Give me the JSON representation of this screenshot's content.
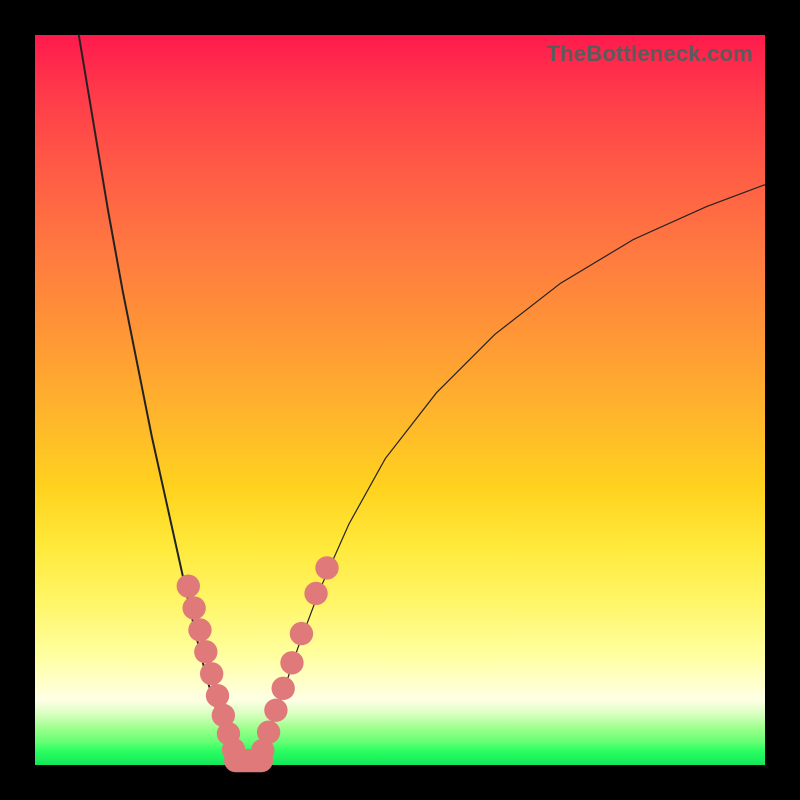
{
  "watermark": "TheBottleneck.com",
  "colors": {
    "frame": "#000000",
    "gradient_top": "#ff1a4d",
    "gradient_mid": "#ffd21e",
    "gradient_bottom": "#12e858",
    "curve": "#222222",
    "bead": "#e07a7a"
  },
  "chart_data": {
    "type": "line",
    "title": "",
    "xlabel": "",
    "ylabel": "",
    "xlim": [
      0,
      100
    ],
    "ylim": [
      0,
      100
    ],
    "series": [
      {
        "name": "left-curve",
        "x": [
          6,
          8,
          10,
          12,
          14,
          16,
          18,
          20,
          22,
          23.5,
          25,
          26,
          27,
          27.8
        ],
        "y": [
          100,
          88,
          76,
          65,
          55,
          45,
          36,
          27,
          18,
          12,
          7,
          4,
          1.5,
          0
        ]
      },
      {
        "name": "valley-floor",
        "x": [
          27.8,
          30.5
        ],
        "y": [
          0,
          0
        ]
      },
      {
        "name": "right-curve",
        "x": [
          30.5,
          32,
          34,
          36,
          39,
          43,
          48,
          55,
          63,
          72,
          82,
          92,
          100
        ],
        "y": [
          0,
          4,
          10,
          16,
          24,
          33,
          42,
          51,
          59,
          66,
          72,
          76.5,
          79.5
        ]
      }
    ],
    "beads_left": [
      {
        "x": 21.0,
        "y": 24.5,
        "r": 1.6
      },
      {
        "x": 21.8,
        "y": 21.5,
        "r": 1.6
      },
      {
        "x": 22.6,
        "y": 18.5,
        "r": 1.6
      },
      {
        "x": 23.4,
        "y": 15.5,
        "r": 1.6
      },
      {
        "x": 24.2,
        "y": 12.5,
        "r": 1.6
      },
      {
        "x": 25.0,
        "y": 9.5,
        "r": 1.6
      },
      {
        "x": 25.8,
        "y": 6.8,
        "r": 1.6
      },
      {
        "x": 26.5,
        "y": 4.3,
        "r": 1.6
      },
      {
        "x": 27.2,
        "y": 2.1,
        "r": 1.6
      }
    ],
    "beads_right": [
      {
        "x": 31.2,
        "y": 2.0,
        "r": 1.6
      },
      {
        "x": 32.0,
        "y": 4.5,
        "r": 1.6
      },
      {
        "x": 33.0,
        "y": 7.5,
        "r": 1.6
      },
      {
        "x": 34.0,
        "y": 10.5,
        "r": 1.6
      },
      {
        "x": 35.2,
        "y": 14.0,
        "r": 1.6
      },
      {
        "x": 36.5,
        "y": 18.0,
        "r": 1.6
      },
      {
        "x": 38.5,
        "y": 23.5,
        "r": 1.6
      },
      {
        "x": 40.0,
        "y": 27.0,
        "r": 1.6
      }
    ],
    "bead_floor": {
      "x0": 27.5,
      "x1": 31.0,
      "y": 0.6,
      "r": 1.6
    }
  }
}
